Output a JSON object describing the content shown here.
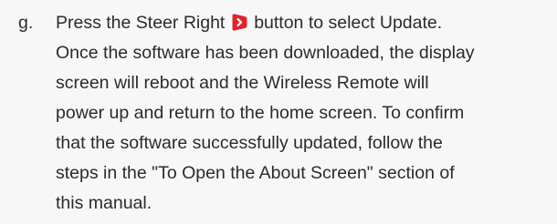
{
  "step": {
    "letter": "g.",
    "lines": [
      {
        "before": "Press the Steer Right",
        "after": "button to select Update."
      },
      "Once the software has been downloaded, the display",
      "screen will reboot and the Wireless Remote will",
      "power up and return to the home screen. To confirm",
      "that the software successfully updated, follow the",
      "steps in the \"To Open the About Screen\" section of",
      "this manual."
    ],
    "icon": {
      "name": "steer-right-icon",
      "color": "#d8282c",
      "glyph_color": "#ffffff"
    }
  }
}
